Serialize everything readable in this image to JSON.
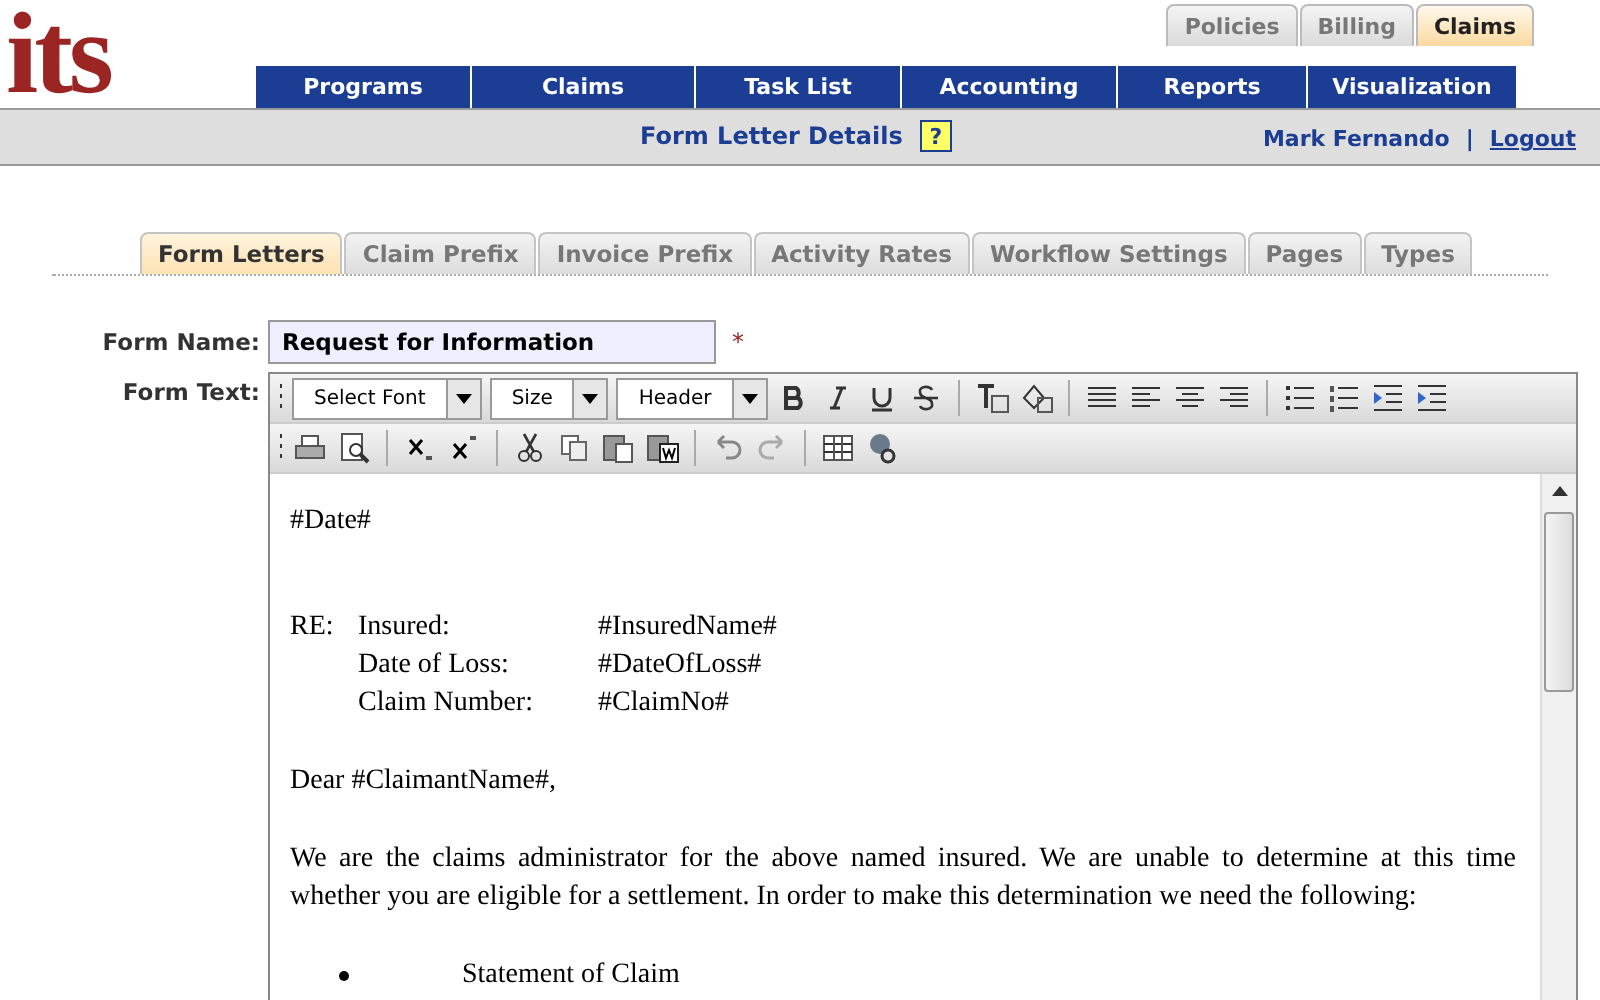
{
  "logo": "its",
  "top_tabs": [
    {
      "label": "Policies",
      "selected": false
    },
    {
      "label": "Billing",
      "selected": false
    },
    {
      "label": "Claims",
      "selected": true
    }
  ],
  "nav": [
    "Programs",
    "Claims",
    "Task List",
    "Accounting",
    "Reports",
    "Visualization"
  ],
  "header": {
    "title": "Form Letter Details",
    "help": "?",
    "user": "Mark Fernando",
    "separator": "|",
    "logout": "Logout"
  },
  "tabs": [
    {
      "label": "Form Letters",
      "selected": true
    },
    {
      "label": "Claim Prefix",
      "selected": false
    },
    {
      "label": "Invoice Prefix",
      "selected": false
    },
    {
      "label": "Activity Rates",
      "selected": false
    },
    {
      "label": "Workflow Settings",
      "selected": false
    },
    {
      "label": "Pages",
      "selected": false
    },
    {
      "label": "Types",
      "selected": false
    }
  ],
  "form": {
    "name_label": "Form Name:",
    "name_value": "Request for Information",
    "required": "*",
    "text_label": "Form Text:"
  },
  "toolbar": {
    "dropdowns": [
      "Select Font",
      "Size",
      "Header"
    ]
  },
  "letter": [
    {
      "kind": "paragraph",
      "text": "#Date#"
    },
    {
      "kind": "spacer"
    },
    {
      "kind": "re",
      "prefix": "RE:",
      "rows": [
        {
          "label": "Insured:",
          "value": "#InsuredName#"
        },
        {
          "label": "Date of Loss:",
          "value": "#DateOfLoss#"
        },
        {
          "label": "Claim Number:",
          "value": "#ClaimNo#"
        }
      ]
    },
    {
      "kind": "paragraph",
      "text": "Dear #ClaimantName#,"
    },
    {
      "kind": "paragraph",
      "text": "We are the claims administrator for the above named insured.  We are unable to determine at this time whether you are eligible for a settlement.  In order to make this determination we need the following:"
    },
    {
      "kind": "bullet",
      "text": "Statement of Claim"
    }
  ]
}
